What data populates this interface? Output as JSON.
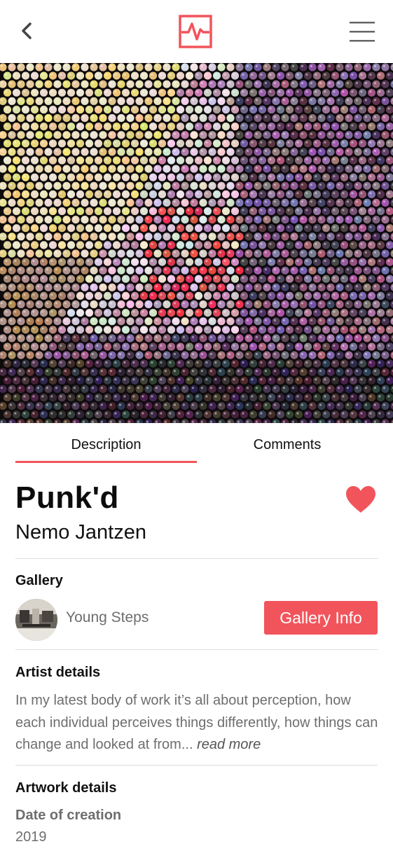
{
  "header": {
    "back_icon": "chevron-left-icon",
    "logo_icon": "pulse-logo-icon",
    "menu_icon": "hamburger-menu-icon"
  },
  "colors": {
    "accent": "#f2545b",
    "text_dark": "#111111",
    "text_muted": "#6e6e6e",
    "divider": "#dcdcdc"
  },
  "tabs": [
    {
      "label": "Description",
      "active": true
    },
    {
      "label": "Comments",
      "active": false
    }
  ],
  "artwork": {
    "title": "Punk'd",
    "artist": "Nemo Jantzen",
    "favorite_icon": "heart-icon",
    "favorited": true
  },
  "gallery": {
    "heading": "Gallery",
    "name": "Young Steps",
    "button_label": "Gallery Info"
  },
  "artist_details": {
    "heading": "Artist details",
    "text": "In my latest body of work it’s all about perception, how each individual perceives things differently, how things can change and looked at from...",
    "read_more": "read more"
  },
  "artwork_details": {
    "heading": "Artwork details",
    "date_label": "Date of creation",
    "date_value": "2019"
  }
}
